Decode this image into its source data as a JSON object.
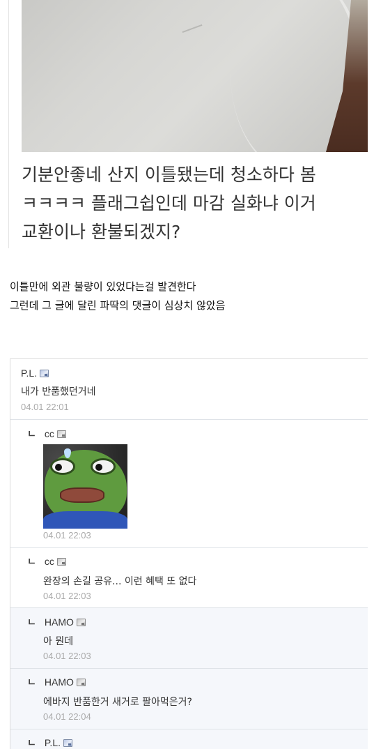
{
  "post": {
    "photo_alt": "",
    "text_lines": [
      "기분안좋네 산지 이틀됐는데 청소하다 봄",
      "ㅋㅋㅋㅋ 플래그쉽인데 마감 실화냐 이거",
      "교환이나 환불되겠지?"
    ]
  },
  "caption": {
    "line1": "이틀만에 외관 불량이 있었다는걸 발견한다",
    "line2": "그런데 그 글에 달린 파딱의 댓글이 심상치 않았음"
  },
  "comments": [
    {
      "nick": "P.L.",
      "text": "내가 반품했던거네",
      "time": "04.01 22:01",
      "badge": "blue-badge-icon"
    },
    {
      "arrow": "ㄴ",
      "nick": "cc",
      "text": "",
      "time": "04.01 22:03",
      "badge": "gray-badge-icon",
      "emoticon": "sad-frog-emoticon"
    },
    {
      "arrow": "ㄴ",
      "nick": "cc",
      "text": "완장의 손길 공유... 이런 혜택 또 없다",
      "time": "04.01 22:03",
      "badge": "gray-badge-icon"
    },
    {
      "arrow": "ㄴ",
      "nick": "HAMO",
      "text": "아 뭔데",
      "time": "04.01 22:03",
      "badge": "gray-badge-icon"
    },
    {
      "arrow": "ㄴ",
      "nick": "HAMO",
      "text": "에바지 반품한거 새거로 팔아먹은거?",
      "time": "04.01 22:04",
      "badge": "gray-badge-icon"
    },
    {
      "arrow": "ㄴ",
      "nick": "P.L.",
      "text": "",
      "time": "",
      "badge": "blue-badge-icon"
    }
  ]
}
